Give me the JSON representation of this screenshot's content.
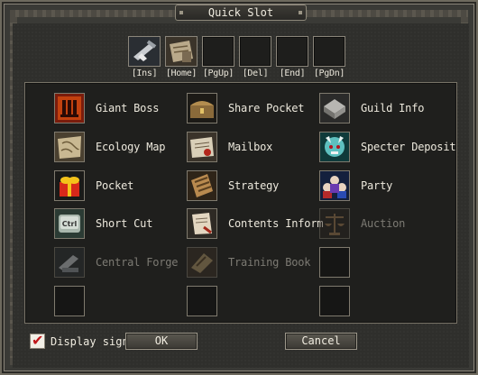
{
  "window": {
    "title": "Quick Slot"
  },
  "hotkeys": [
    {
      "label": "[Ins]",
      "filled": "pickaxe"
    },
    {
      "label": "[Home]",
      "filled": "map"
    },
    {
      "label": "[PgUp]",
      "filled": ""
    },
    {
      "label": "[Del]",
      "filled": ""
    },
    {
      "label": "[End]",
      "filled": ""
    },
    {
      "label": "[PgDn]",
      "filled": ""
    }
  ],
  "items": {
    "giant_boss": "Giant Boss",
    "share_pocket": "Share Pocket",
    "guild_info": "Guild Info",
    "ecology_map": "Ecology Map",
    "mailbox": "Mailbox",
    "specter_deposit": "Specter Deposit",
    "pocket": "Pocket",
    "strategy": "Strategy",
    "party": "Party",
    "short_cut": "Short Cut",
    "contents_inform": "Contents Inform",
    "auction": "Auction",
    "central_forge": "Central Forge",
    "training_book": "Training Book"
  },
  "footer": {
    "display_sign": "Display sign",
    "display_sign_checked": true,
    "ok": "OK",
    "cancel": "Cancel"
  },
  "colors": {
    "accent_red": "#c0171a",
    "text": "#ece8dc",
    "disabled_text": "#7c7a73"
  }
}
